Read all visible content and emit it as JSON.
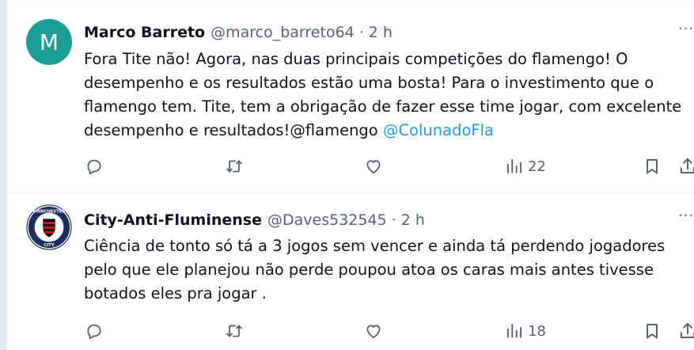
{
  "tweets": [
    {
      "avatar_letter": "M",
      "name": "Marco Barreto",
      "handle": "@marco_barreto64",
      "time": "2 h",
      "lines": [
        "Fora Tite não! Agora, nas duas principais competições do flamengo! O",
        "desempenho e os resultados estão uma bosta! Para o investimento que o",
        "flamengo tem. Tite, tem a obrigação de fazer esse time jogar, com excelente",
        "desempenho e resultados!@flamengo "
      ],
      "mention": "@ColunadoFla",
      "views": "22"
    },
    {
      "avatar_logo_text_top": "MANCHESTER",
      "avatar_logo_text_bottom": "CITY",
      "name": "City-Anti-Fluminense",
      "handle": "@Daves532545",
      "time": "2 h",
      "lines": [
        "Ciência de tonto só tá a 3 jogos sem vencer e ainda tá perdendo jogadores",
        "pelo que ele planejou não perde poupou atoa os caras mais antes tivesse",
        "botados eles pra jogar ."
      ],
      "views": "18"
    }
  ],
  "separator": "·",
  "more_glyph": "···",
  "icons": [
    "reply-icon",
    "retweet-icon",
    "like-icon",
    "views-icon",
    "bookmark-icon",
    "share-icon"
  ],
  "colors": {
    "link": "#1d9bf0",
    "muted": "#536471",
    "avatar_m": "#1a9e96"
  }
}
